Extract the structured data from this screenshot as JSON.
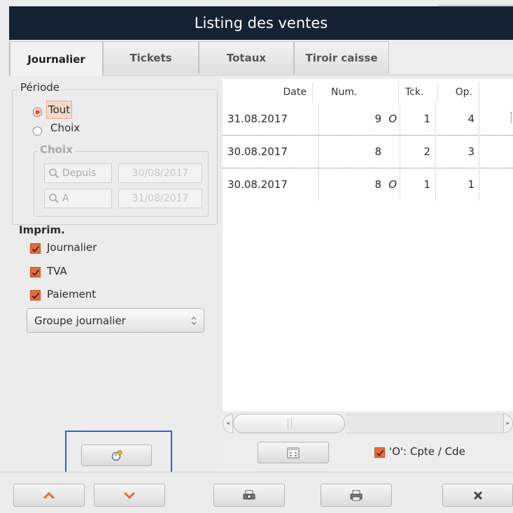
{
  "window": {
    "title": "Listing des ventes"
  },
  "tabs": [
    {
      "label": "Journalier",
      "active": true
    },
    {
      "label": "Tickets",
      "active": false
    },
    {
      "label": "Totaux",
      "active": false
    },
    {
      "label": "Tiroir caisse",
      "active": false
    }
  ],
  "periode": {
    "legend": "Période",
    "options": [
      {
        "label": "Tout",
        "selected": true
      },
      {
        "label": "Choix",
        "selected": false
      }
    ],
    "choix": {
      "legend": "Choix",
      "depuis_label": "Depuis",
      "depuis_value": "30/08/2017",
      "a_label": "A",
      "a_value": "31/08/2017"
    }
  },
  "imprim": {
    "legend": "Imprim.",
    "options": [
      {
        "label": "Journalier",
        "checked": true
      },
      {
        "label": "TVA",
        "checked": true
      },
      {
        "label": "Paiement",
        "checked": true
      }
    ],
    "group_select": "Groupe journalier"
  },
  "table": {
    "columns": [
      "Date",
      "Num.",
      "Tck.",
      "Op."
    ],
    "rows": [
      {
        "date": "31.08.2017",
        "num": "9",
        "flag": "O",
        "tck": "1",
        "op": "4"
      },
      {
        "date": "30.08.2017",
        "num": "8",
        "flag": "",
        "tck": "2",
        "op": "3"
      },
      {
        "date": "30.08.2017",
        "num": "8",
        "flag": "O",
        "tck": "1",
        "op": "1"
      }
    ]
  },
  "legend_check": {
    "label": "'O': Cpte / Cde",
    "checked": true
  },
  "icons": {
    "timer": "stopwatch-icon",
    "calendar": "calendar-icon",
    "up": "chevron-up-icon",
    "down": "chevron-down-icon",
    "preview": "print-preview-icon",
    "print": "printer-icon",
    "close": "close-icon"
  },
  "colors": {
    "titlebar": "#152233",
    "accent": "#e66b3c",
    "focus": "#2f62d8"
  }
}
